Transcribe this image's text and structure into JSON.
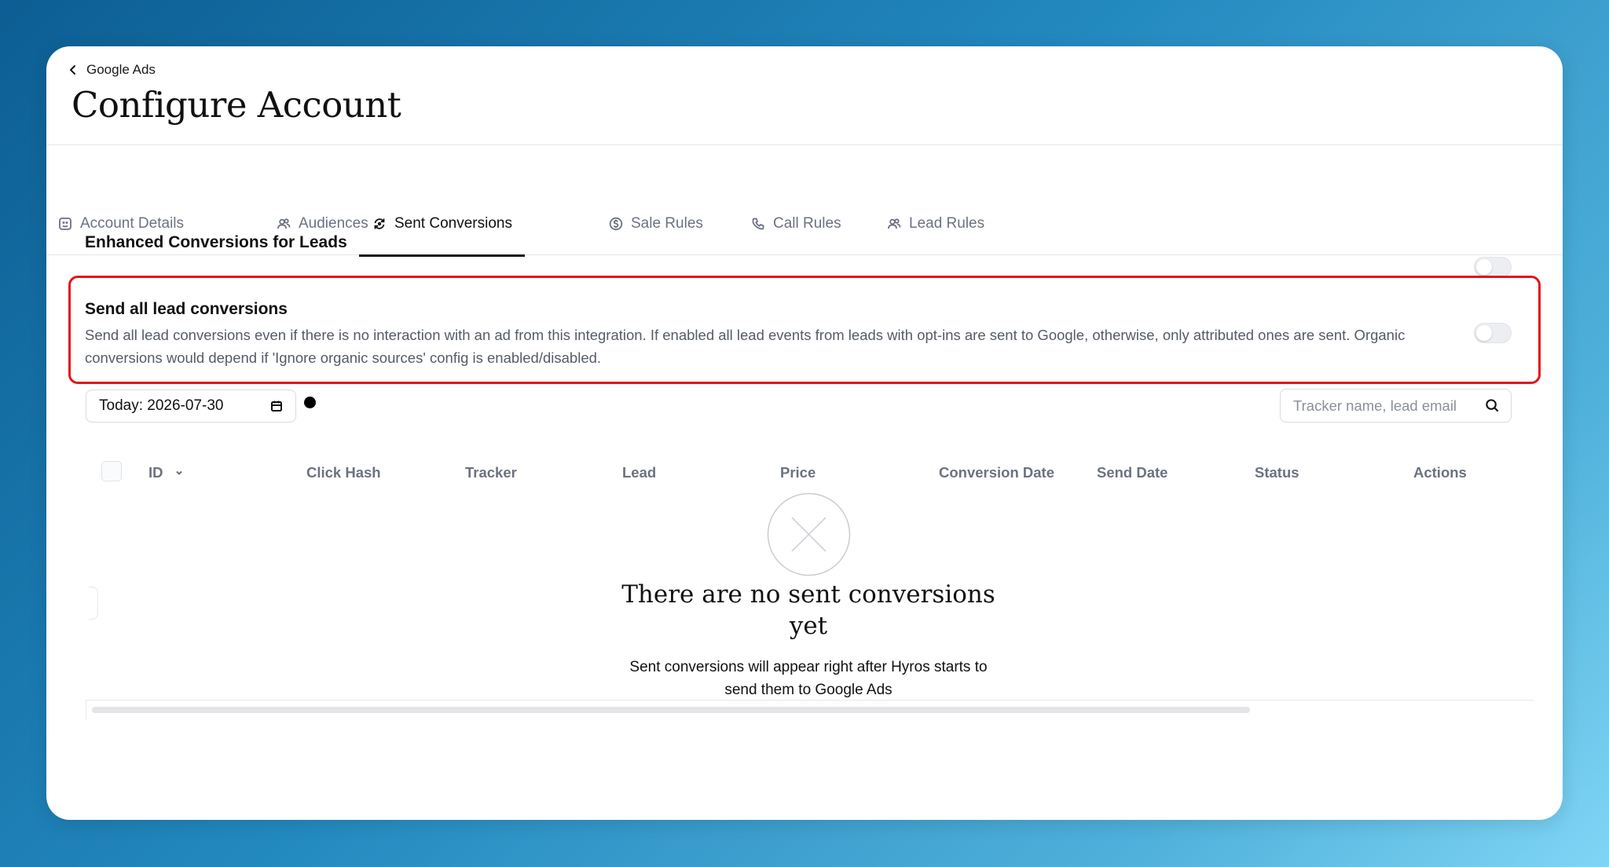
{
  "header": {
    "back_label": "Google Ads",
    "title": "Configure Account"
  },
  "tabs": [
    {
      "label": "Account Details",
      "icon": "account-details-icon",
      "active": false
    },
    {
      "label": "Audiences",
      "icon": "users-icon",
      "active": false
    },
    {
      "label": "Sent Conversions",
      "icon": "refresh-icon",
      "active": true
    },
    {
      "label": "Sale Rules",
      "icon": "dollar-circle-icon",
      "active": false
    },
    {
      "label": "Call Rules",
      "icon": "phone-icon",
      "active": false
    },
    {
      "label": "Lead Rules",
      "icon": "users-icon",
      "active": false
    }
  ],
  "enhanced": {
    "title": "Enhanced Conversions for Leads",
    "enabled": false
  },
  "send_all": {
    "title": "Send all lead conversions",
    "description": "Send all lead conversions even if there is no interaction with an ad from this integration. If enabled all lead events from leads with opt-ins are sent to Google, otherwise, only attributed ones are sent. Organic conversions would depend if 'Ignore organic sources' config is enabled/disabled.",
    "enabled": false
  },
  "filters": {
    "date_label": "Today: 2026-07-30",
    "search_placeholder": "Tracker name, lead email"
  },
  "table": {
    "columns": [
      "ID",
      "Click Hash",
      "Tracker",
      "Lead",
      "Price",
      "Conversion Date",
      "Send Date",
      "Status",
      "Actions"
    ]
  },
  "empty_state": {
    "title": "There are no sent conversions yet",
    "description": "Sent conversions will appear right after Hyros starts to send them to Google Ads"
  },
  "colors": {
    "highlight_border": "#e3141b",
    "active_tab": "#111111",
    "muted_text": "#6b7280"
  }
}
